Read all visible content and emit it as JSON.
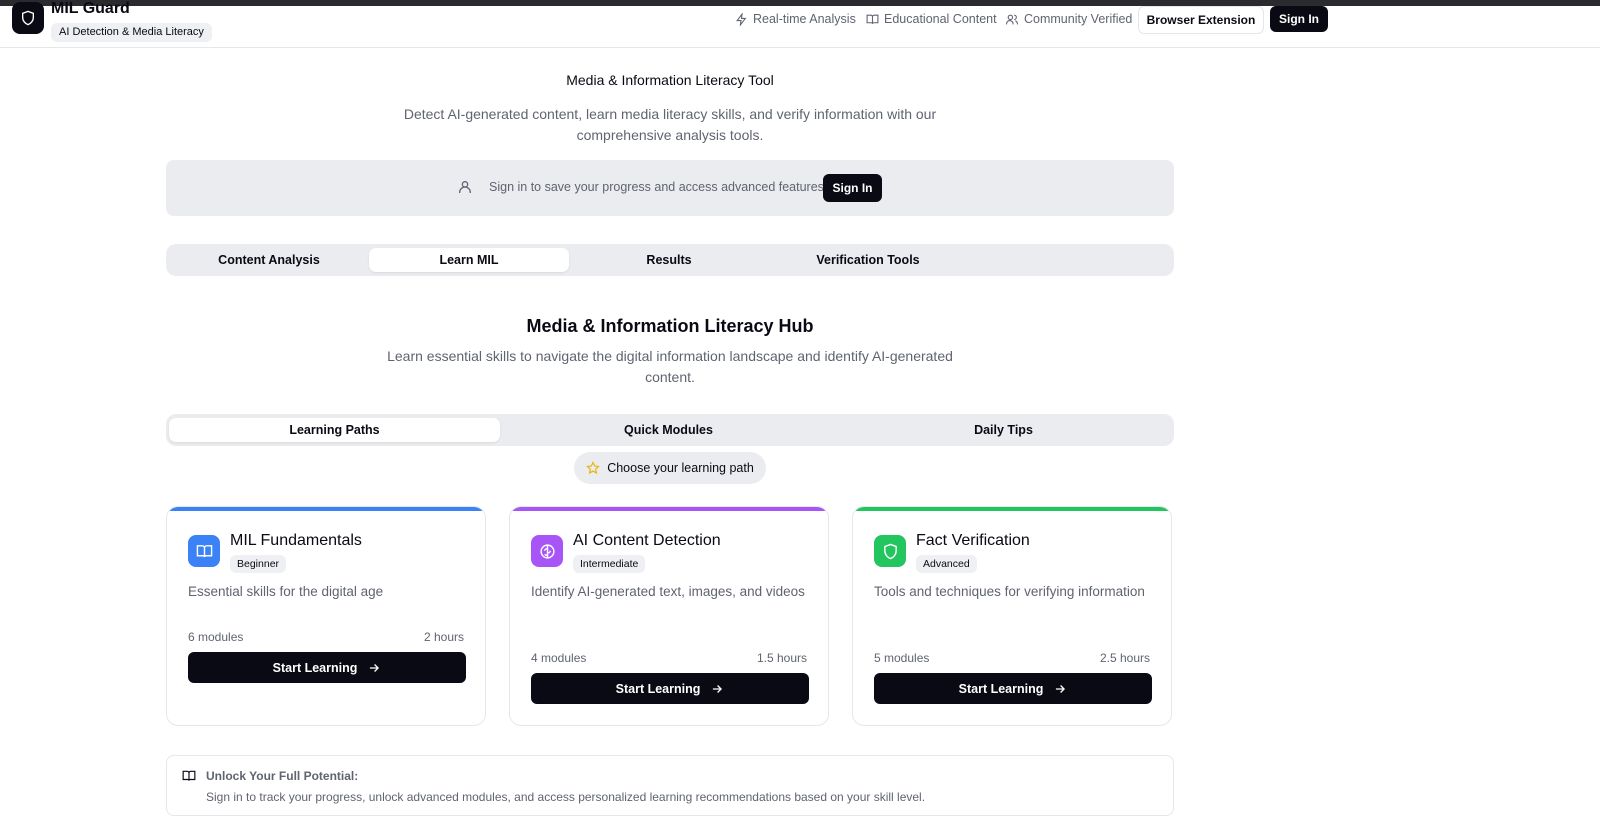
{
  "header": {
    "brand_title": "MIL Guard",
    "brand_badge": "AI Detection & Media Literacy",
    "nav": [
      {
        "label": "Real-time Analysis",
        "icon": "bolt-icon"
      },
      {
        "label": "Educational Content",
        "icon": "book-icon"
      },
      {
        "label": "Community Verified",
        "icon": "users-icon"
      }
    ],
    "browser_extension_label": "Browser Extension",
    "sign_in_label": "Sign In"
  },
  "intro": {
    "eyebrow": "Media & Information Literacy Tool",
    "subtitle_line1": "Detect AI-generated content, learn media literacy skills, and verify information with our",
    "subtitle_line2": "comprehensive analysis tools."
  },
  "signin_panel": {
    "message": "Sign in to save your progress and access advanced features",
    "button": "Sign In"
  },
  "main_tabs": [
    {
      "label": "Content Analysis",
      "active": false
    },
    {
      "label": "Learn MIL",
      "active": true
    },
    {
      "label": "Results",
      "active": false
    },
    {
      "label": "Verification Tools",
      "active": false
    }
  ],
  "hub": {
    "title": "Media & Information Literacy Hub",
    "subtitle_line1": "Learn essential skills to navigate the digital information landscape and identify AI-generated",
    "subtitle_line2": "content."
  },
  "sub_tabs": [
    {
      "label": "Learning Paths",
      "active": true
    },
    {
      "label": "Quick Modules",
      "active": false
    },
    {
      "label": "Daily Tips",
      "active": false
    }
  ],
  "path_pill": {
    "label": "Choose your learning path",
    "icon": "star-icon"
  },
  "cards": [
    {
      "title": "MIL Fundamentals",
      "level": "Beginner",
      "description": "Essential skills for the digital age",
      "modules": "6 modules",
      "duration": "2 hours",
      "button": "Start Learning",
      "accent": "#3b82f6",
      "icon": "book-open-icon"
    },
    {
      "title": "AI Content Detection",
      "level": "Intermediate",
      "description": "Identify AI-generated text, images, and videos",
      "modules": "4 modules",
      "duration": "1.5 hours",
      "button": "Start Learning",
      "accent": "#a855f7",
      "icon": "brain-icon"
    },
    {
      "title": "Fact Verification",
      "level": "Advanced",
      "description": "Tools and techniques for verifying information",
      "modules": "5 modules",
      "duration": "2.5 hours",
      "button": "Start Learning",
      "accent": "#22c55e",
      "icon": "shield-icon"
    }
  ],
  "unlock": {
    "title": "Unlock Your Full Potential:",
    "text": "Sign in to track your progress, unlock advanced modules, and access personalized learning recommendations based on your skill level."
  }
}
